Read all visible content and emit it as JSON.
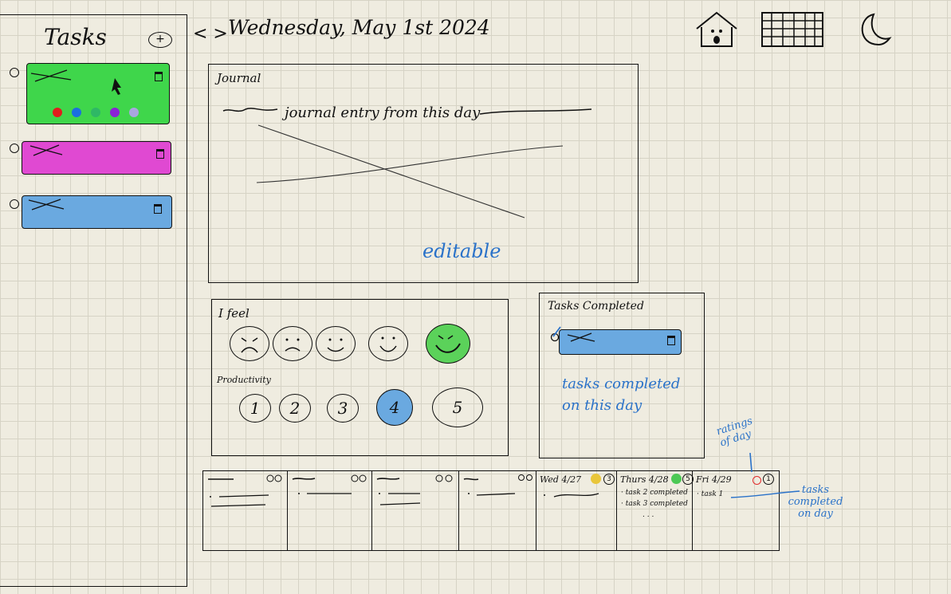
{
  "sidebar": {
    "title": "Tasks",
    "add_icon": "plus-circle-icon",
    "tasks": [
      {
        "color": "#3fd64b",
        "dots": [
          "#e11d1d",
          "#1b6fe0",
          "#2fb865",
          "#8a22d6",
          "#a9a6e0"
        ]
      },
      {
        "color": "#e049d2"
      },
      {
        "color": "#6aa9e0"
      }
    ]
  },
  "header": {
    "nav": "< >",
    "date": "Wednesday, May 1st 2024",
    "icons": [
      "home-icon",
      "calendar-icon",
      "moon-icon"
    ]
  },
  "journal": {
    "label": "Journal",
    "entry": "journal entry from this day",
    "note": "editable"
  },
  "mood": {
    "feel_label": "I feel",
    "feel_selected": 5,
    "productivity_label": "Productivity",
    "productivity_values": [
      "1",
      "2",
      "3",
      "4",
      "5"
    ],
    "productivity_selected": 4,
    "highlight_green": "#5bd25a",
    "highlight_blue": "#6aa9e0"
  },
  "completed": {
    "label": "Tasks Completed",
    "note": "tasks completed on this day"
  },
  "week": {
    "days": [
      {
        "label": "Wed 4/27",
        "rating": "3",
        "tasks": []
      },
      {
        "label": "Thurs 4/28",
        "rating": "5",
        "tasks": [
          "· task 2 completed",
          "· task 3 completed",
          ". . ."
        ]
      },
      {
        "label": "Fri 4/29",
        "rating": "1",
        "tasks": [
          "· task 1"
        ]
      }
    ]
  },
  "annotations": {
    "ratings": "ratings of day",
    "tasks": "tasks completed on day"
  }
}
